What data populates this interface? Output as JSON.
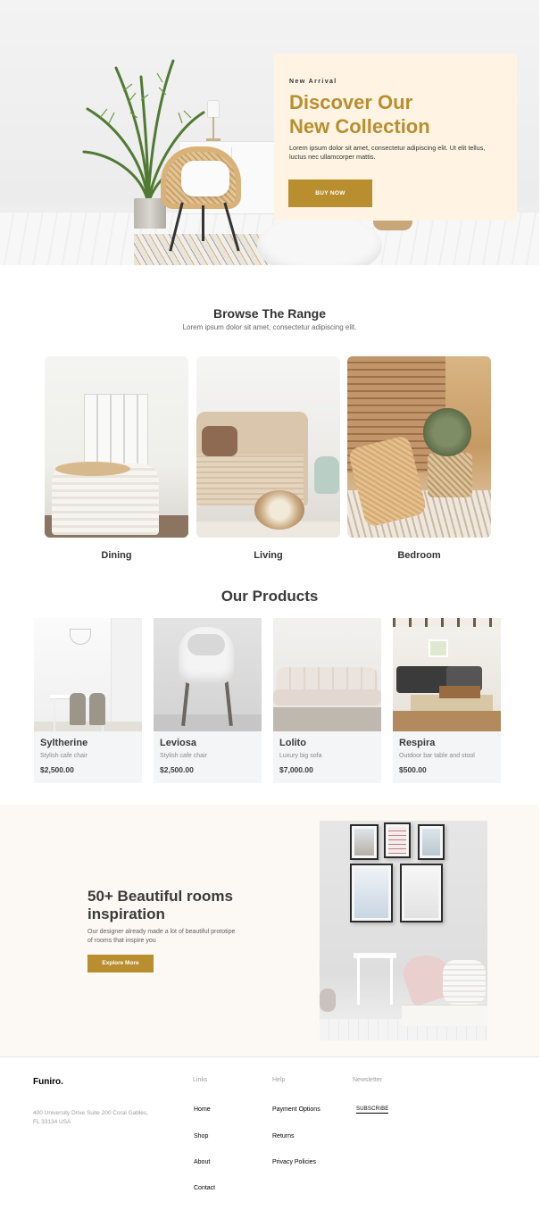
{
  "hero": {
    "eyebrow": "New Arrival",
    "title_line1": "Discover Our",
    "title_line2": "New Collection",
    "text": "Lorem ipsum dolor sit amet, consectetur adipiscing elit. Ut elit tellus, luctus nec ullamcorper mattis.",
    "button": "BUY NOW"
  },
  "browse": {
    "title": "Browse The Range",
    "subtitle": "Lorem ipsum dolor sit amet, consectetur adipiscing elit.",
    "items": [
      {
        "label": "Dining"
      },
      {
        "label": "Living"
      },
      {
        "label": "Bedroom"
      }
    ]
  },
  "products": {
    "title": "Our Products",
    "items": [
      {
        "name": "Syltherine",
        "desc": "Stylish cafe chair",
        "price": "$2,500.00"
      },
      {
        "name": "Leviosa",
        "desc": "Stylish cafe chair",
        "price": "$2,500.00"
      },
      {
        "name": "Lolito",
        "desc": "Luxury big sofa",
        "price": "$7,000.00"
      },
      {
        "name": "Respira",
        "desc": "Outdoor bar table and stool",
        "price": "$500.00"
      }
    ]
  },
  "inspiration": {
    "title": "50+ Beautiful rooms inspiration",
    "text": "Our designer already made a lot of beautiful prototipe of rooms that inspire you",
    "button": "Explore More"
  },
  "footer": {
    "brand": "Funiro.",
    "address": "400 University Drive Suite 200 Coral Gables, FL 33134 USA",
    "links_head": "Links",
    "links": [
      "Home",
      "Shop",
      "About",
      "Contact"
    ],
    "help_head": "Help",
    "help": [
      "Payment Options",
      "Returns",
      "Privacy Policies"
    ],
    "newsletter_head": "Newsletter",
    "subscribe": "SUBSCRIBE"
  },
  "colors": {
    "accent": "#b88e2f",
    "hero_card": "#fff3e3",
    "inspiration_bg": "#fcf8f3",
    "product_card": "#f4f5f7"
  }
}
